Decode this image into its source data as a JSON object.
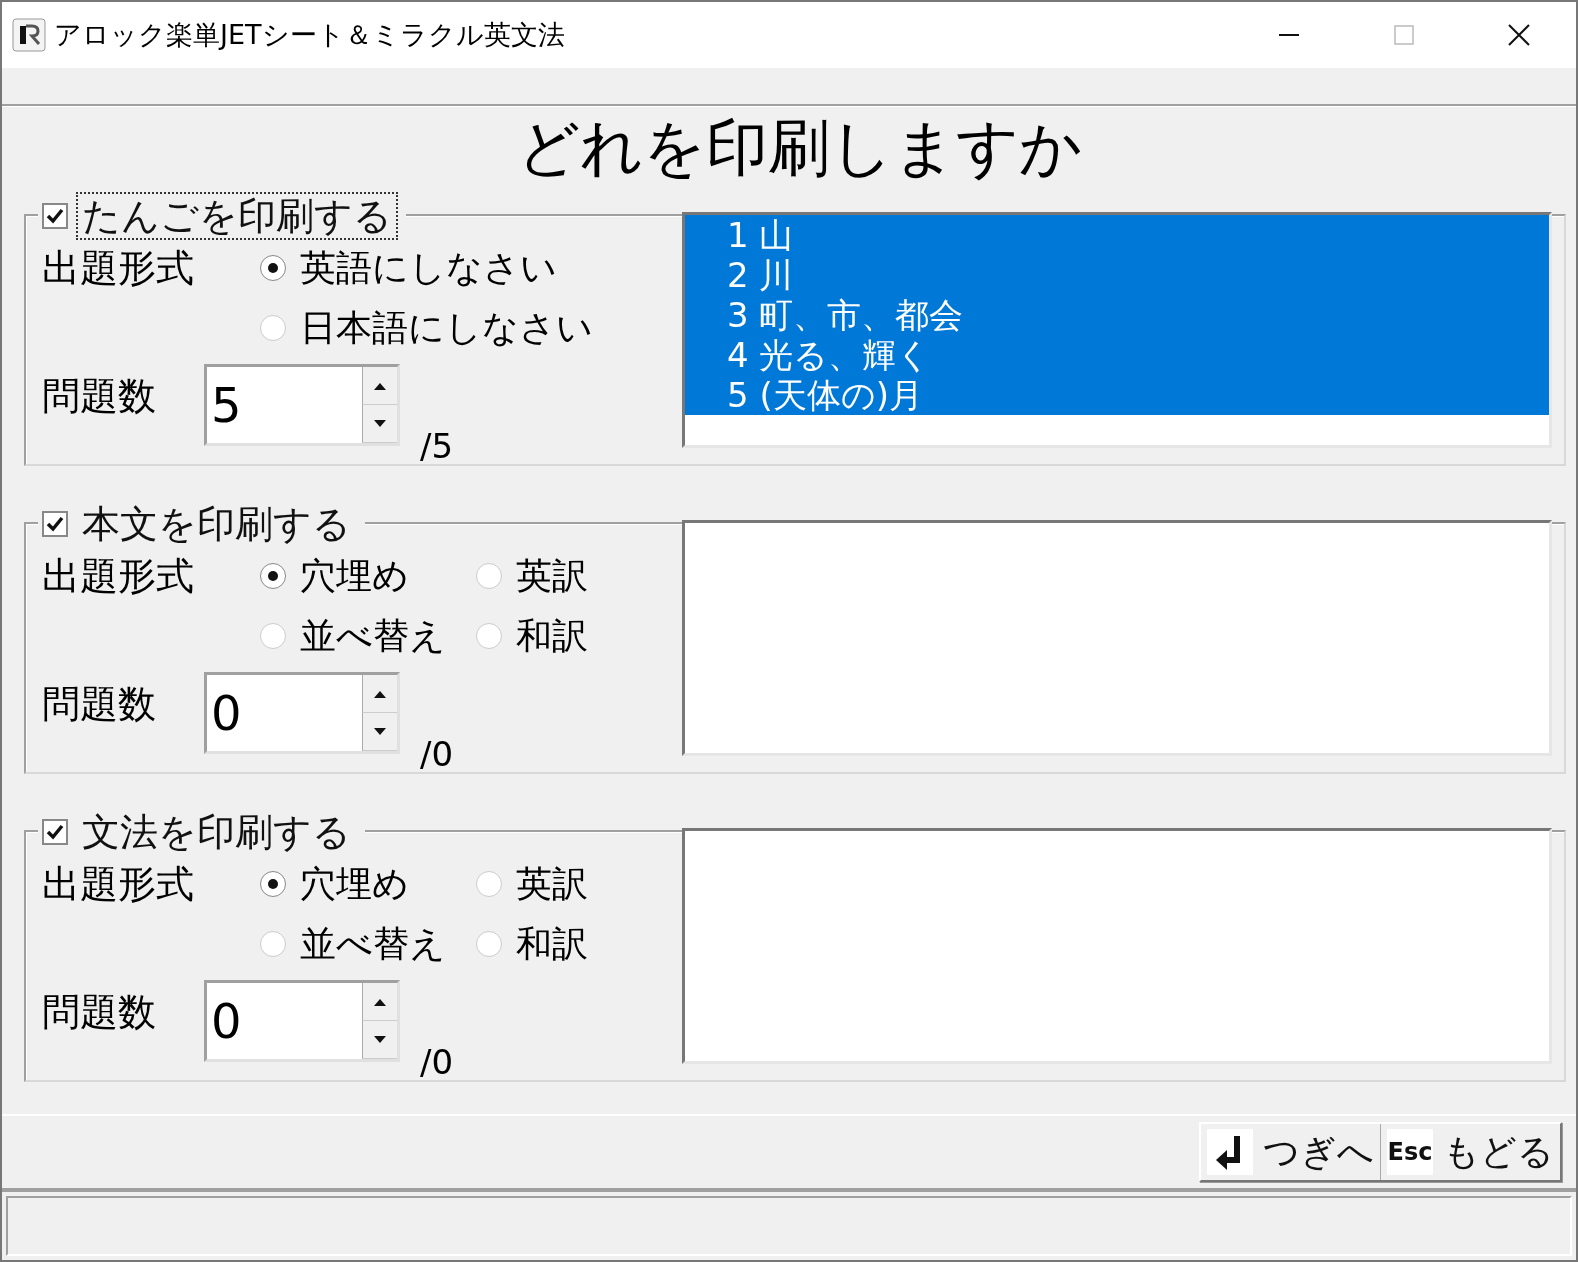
{
  "window": {
    "title": "アロック楽単JETシート＆ミラクル英文法"
  },
  "heading": "どれを印刷しますか",
  "sections": [
    {
      "label": "たんごを印刷する",
      "checked": true,
      "focused": true,
      "format_label": "出題形式",
      "options": [
        {
          "label": "英語にしなさい",
          "selected": true
        },
        {
          "label": "日本語にしなさい",
          "selected": false
        }
      ],
      "count_label": "問題数",
      "count_value": "5",
      "count_total": "/5",
      "list_items": [
        {
          "text": "1 山",
          "selected": true
        },
        {
          "text": "2 川",
          "selected": true
        },
        {
          "text": "3 町、市、都会",
          "selected": true
        },
        {
          "text": "4 光る、輝く",
          "selected": true
        },
        {
          "text": "5 (天体の)月",
          "selected": true
        }
      ]
    },
    {
      "label": "本文を印刷する",
      "checked": true,
      "focused": false,
      "format_label": "出題形式",
      "options": [
        {
          "label": "穴埋め",
          "selected": true
        },
        {
          "label": "英訳",
          "selected": false
        },
        {
          "label": "並べ替え",
          "selected": false
        },
        {
          "label": "和訳",
          "selected": false
        }
      ],
      "count_label": "問題数",
      "count_value": "0",
      "count_total": "/0"
    },
    {
      "label": "文法を印刷する",
      "checked": true,
      "focused": false,
      "format_label": "出題形式",
      "options": [
        {
          "label": "穴埋め",
          "selected": true
        },
        {
          "label": "英訳",
          "selected": false
        },
        {
          "label": "並べ替え",
          "selected": false
        },
        {
          "label": "和訳",
          "selected": false
        }
      ],
      "count_label": "問題数",
      "count_value": "0",
      "count_total": "/0"
    }
  ],
  "buttons": [
    {
      "kind": "enter",
      "label": "つぎへ"
    },
    {
      "kind": "esc",
      "key_label": "Esc",
      "label": "もどる"
    }
  ]
}
